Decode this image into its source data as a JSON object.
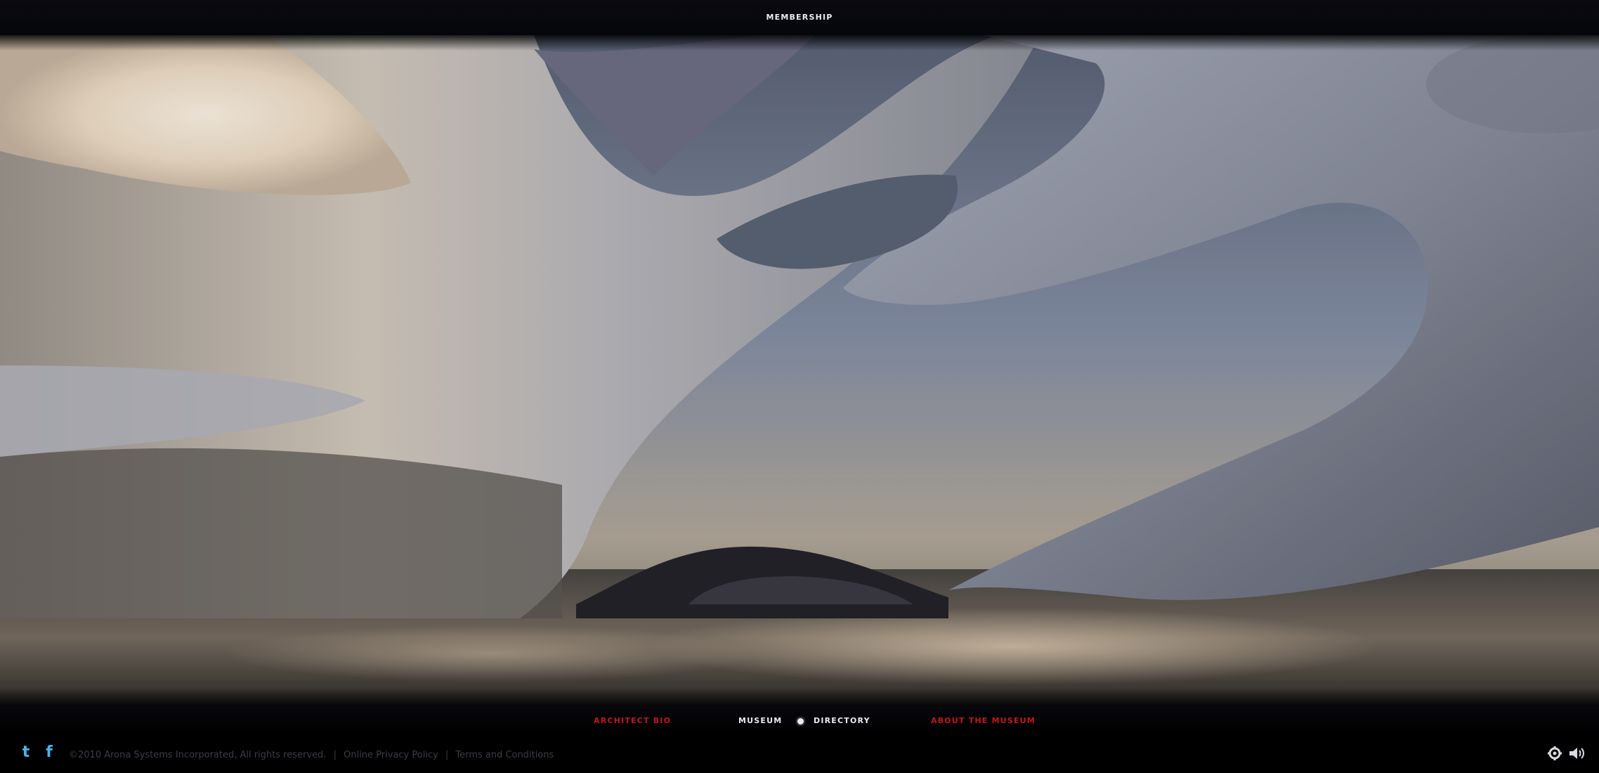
{
  "header": {
    "membership_label": "MEMBERSHIP"
  },
  "hero": {
    "description_icon": "architectural-interior-render"
  },
  "bottom_nav": {
    "architect_bio": "ARCHITECT BIO",
    "museum": "MUSEUM",
    "directory": "DIRECTORY",
    "about": "ABOUT THE MUSEUM"
  },
  "footer": {
    "copyright": "©2010 Arona Systems Incorporated, All rights reserved.",
    "privacy": "Online Privacy Policy",
    "separator": "|",
    "terms": "Terms and Conditions"
  },
  "icons": {
    "twitter": "twitter-icon",
    "facebook": "facebook-icon",
    "settings": "gear-icon",
    "sound": "speaker-icon"
  },
  "colors": {
    "nav_red": "#c4141c",
    "nav_white": "#e9ecf2",
    "twitter_blue": "#4fb3e8"
  }
}
